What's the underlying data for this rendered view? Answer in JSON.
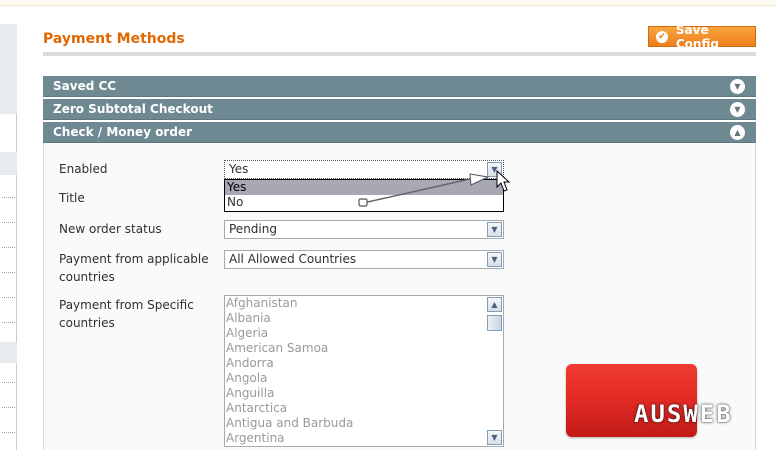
{
  "header": {
    "title": "Payment Methods",
    "save_label": "Save Config"
  },
  "sections": [
    {
      "title": "Saved CC",
      "state": "collapsed"
    },
    {
      "title": "Zero Subtotal Checkout",
      "state": "collapsed"
    },
    {
      "title": "Check / Money order",
      "state": "expanded"
    }
  ],
  "form": {
    "enabled": {
      "label": "Enabled",
      "value": "Yes",
      "options": [
        "Yes",
        "No"
      ],
      "highlighted_option": "Yes"
    },
    "title": {
      "label": "Title"
    },
    "new_order_status": {
      "label": "New order status",
      "value": "Pending"
    },
    "applicable_countries": {
      "label_line1": "Payment from applicable",
      "label_line2": "countries",
      "value": "All Allowed Countries"
    },
    "specific_countries": {
      "label_line1": "Payment from Specific",
      "label_line2": "countries",
      "options": [
        "Afghanistan",
        "Albania",
        "Algeria",
        "American Samoa",
        "Andorra",
        "Angola",
        "Anguilla",
        "Antarctica",
        "Antigua and Barbuda",
        "Argentina"
      ]
    }
  },
  "watermark": {
    "text": "AUSWEB"
  },
  "colors": {
    "accent": "#e26703",
    "save_button": "#f18b2b",
    "section_header": "#6f8992",
    "highlight_option": "#a8a8b4",
    "logo_red": "#e12a24"
  },
  "icons": {
    "save": "check-circle-icon",
    "collapsed": "chevron-down-circle-icon",
    "expanded": "chevron-up-circle-icon",
    "select": "chevron-down-icon",
    "cursor": "mouse-pointer-icon"
  }
}
